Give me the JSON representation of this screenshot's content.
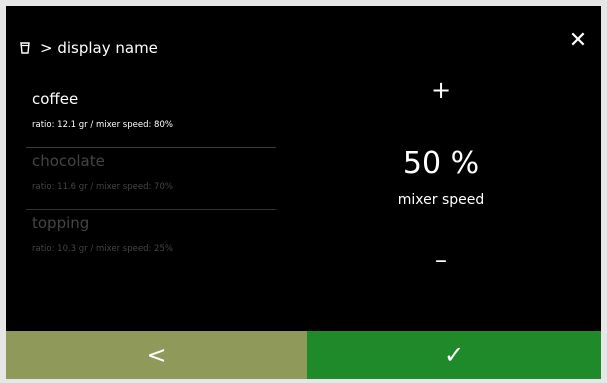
{
  "header": {
    "breadcrumb": "> display name",
    "icon": "cup-icon",
    "close_glyph": "✕"
  },
  "list": {
    "items": [
      {
        "name": "coffee",
        "ratio": "ratio: 12.1 gr / mixer speed: 80%",
        "active": true
      },
      {
        "name": "chocolate",
        "ratio": "ratio: 11.6 gr / mixer speed: 70%",
        "active": false
      },
      {
        "name": "topping",
        "ratio": "ratio: 10.3 gr / mixer speed: 25%",
        "active": false
      }
    ]
  },
  "adjuster": {
    "plus_glyph": "+",
    "minus_glyph": "–",
    "value": "50 %",
    "label": "mixer speed"
  },
  "footer": {
    "back_glyph": "<",
    "confirm_glyph": "✓",
    "back_color": "#8f9a5a",
    "confirm_color": "#1f8a2a"
  }
}
